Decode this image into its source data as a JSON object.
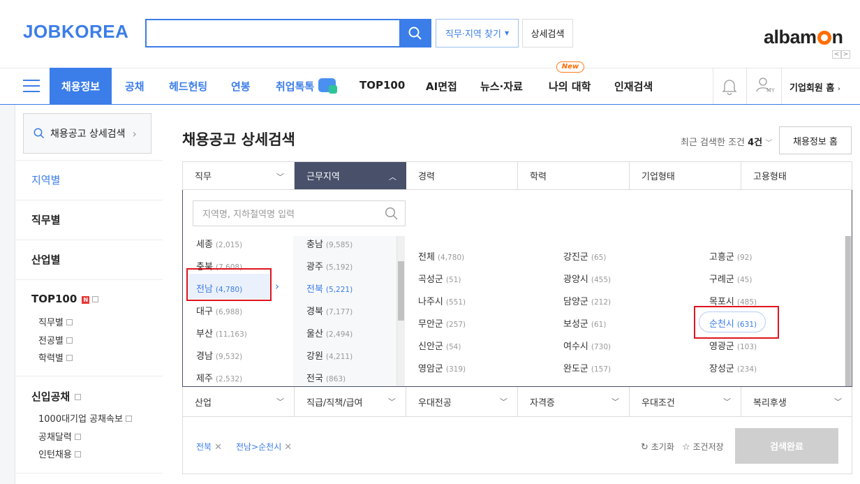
{
  "header": {
    "logo": "JOBKOREA",
    "search_value": "",
    "job_area_btn": "직무·지역 찾기",
    "detail_search_btn": "상세검색",
    "albamon_pre": "alba",
    "albamon_post": "n",
    "albamon_m": "m"
  },
  "gnb": {
    "active": "채용정보",
    "items": [
      "공채",
      "헤드헌팅",
      "연봉",
      "취업톡톡",
      "TOP100",
      "AI면접",
      "뉴스·자료",
      "나의 대학",
      "인재검색"
    ],
    "new_badge": "New",
    "my_label": "MY",
    "corp_home": "기업회원 홈"
  },
  "sidebar": {
    "search_label": "채용공고 상세검색",
    "categories": [
      "지역별",
      "직무별",
      "산업별",
      "TOP100",
      "신입공채"
    ],
    "top100_badge": "N",
    "top100_subs": [
      "직무별",
      "전공별",
      "학력별"
    ],
    "gongchae_subs": [
      "1000대기업 공채속보",
      "공채달력",
      "인턴채용"
    ]
  },
  "main": {
    "title": "채용공고 상세검색",
    "recent_prefix": "최근 검색한 조건",
    "recent_count": "4건",
    "job_home_btn": "채용정보 홈",
    "tabs": [
      "직무",
      "근무지역",
      "경력",
      "학력",
      "기업형태",
      "고용형태"
    ],
    "tabs2": [
      "산업",
      "직급/직책/급여",
      "우대전공",
      "자격증",
      "우대조건",
      "복리후생"
    ],
    "area_placeholder": "지역명, 지하철역명 입력",
    "regions_col1": [
      {
        "name": "세종",
        "count": "(2,015)"
      },
      {
        "name": "충북",
        "count": "(7,608)"
      },
      {
        "name": "전남",
        "count": "(4,780)"
      },
      {
        "name": "대구",
        "count": "(6,988)"
      },
      {
        "name": "부산",
        "count": "(11,163)"
      },
      {
        "name": "경남",
        "count": "(9,532)"
      },
      {
        "name": "제주",
        "count": "(2,532)"
      }
    ],
    "regions_col2": [
      {
        "name": "충남",
        "count": "(9,585)"
      },
      {
        "name": "광주",
        "count": "(5,192)"
      },
      {
        "name": "전북",
        "count": "(5,221)"
      },
      {
        "name": "경북",
        "count": "(7,177)"
      },
      {
        "name": "울산",
        "count": "(2,494)"
      },
      {
        "name": "강원",
        "count": "(4,211)"
      },
      {
        "name": "전국",
        "count": "(863)"
      }
    ],
    "cities": [
      [
        {
          "name": "전체",
          "count": "(4,780)"
        },
        {
          "name": "강진군",
          "count": "(65)"
        },
        {
          "name": "고흥군",
          "count": "(92)"
        }
      ],
      [
        {
          "name": "곡성군",
          "count": "(51)"
        },
        {
          "name": "광양시",
          "count": "(455)"
        },
        {
          "name": "구례군",
          "count": "(45)"
        }
      ],
      [
        {
          "name": "나주시",
          "count": "(551)"
        },
        {
          "name": "담양군",
          "count": "(212)"
        },
        {
          "name": "목포시",
          "count": "(485)"
        }
      ],
      [
        {
          "name": "무안군",
          "count": "(257)"
        },
        {
          "name": "보성군",
          "count": "(61)"
        },
        {
          "name": "순천시",
          "count": "(631)"
        }
      ],
      [
        {
          "name": "신안군",
          "count": "(54)"
        },
        {
          "name": "여수시",
          "count": "(730)"
        },
        {
          "name": "영광군",
          "count": "(103)"
        }
      ],
      [
        {
          "name": "영암군",
          "count": "(319)"
        },
        {
          "name": "완도군",
          "count": "(157)"
        },
        {
          "name": "장성군",
          "count": "(234)"
        }
      ]
    ],
    "chips": [
      "전북",
      "전남>순천시"
    ],
    "reset": "초기화",
    "save": "조건저장",
    "done": "검색완료"
  },
  "colors": {
    "brand": "#3b7de9",
    "active_tab": "#48506a",
    "highlight": "#e0141e",
    "albamon_orange": "#ff6d00"
  }
}
